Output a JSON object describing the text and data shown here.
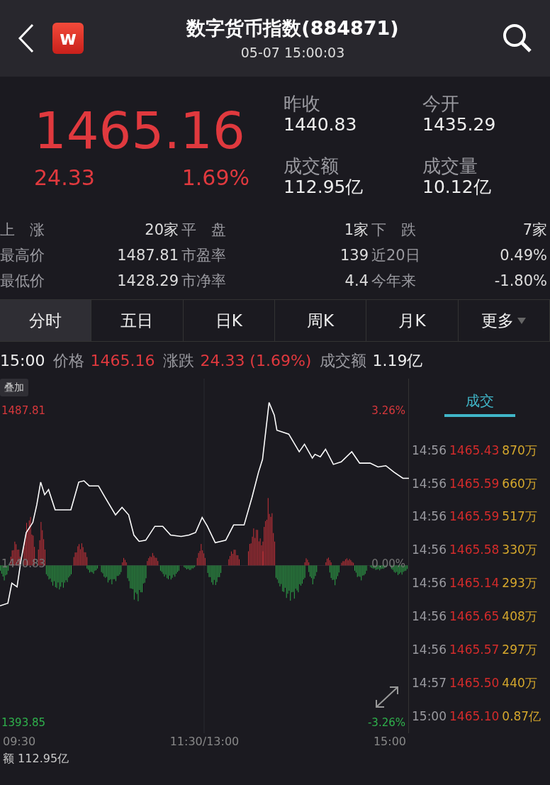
{
  "header": {
    "logo_text": "w",
    "title": "数字货币指数(884871)",
    "time": "05-07 15:00:03"
  },
  "quote": {
    "price": "1465.16",
    "change": "24.33",
    "change_pct": "1.69%",
    "fields": [
      {
        "label": "昨收",
        "value": "1440.83"
      },
      {
        "label": "今开",
        "value": "1435.29"
      },
      {
        "label": "成交额",
        "value": "112.95亿"
      },
      {
        "label": "成交量",
        "value": "10.12亿"
      }
    ]
  },
  "stats": [
    [
      {
        "label": "上　涨",
        "value": "20家"
      },
      {
        "label": "平　盘",
        "value": "1家"
      },
      {
        "label": "下　跌",
        "value": "7家"
      }
    ],
    [
      {
        "label": "最高价",
        "value": "1487.81"
      },
      {
        "label": "市盈率",
        "value": "139"
      },
      {
        "label": "近20日",
        "value": "0.49%"
      }
    ],
    [
      {
        "label": "最低价",
        "value": "1428.29"
      },
      {
        "label": "市净率",
        "value": "4.4"
      },
      {
        "label": "今年来",
        "value": "-1.80%"
      }
    ]
  ],
  "tabs": [
    {
      "label": "分时",
      "selected": true,
      "kind": "tab"
    },
    {
      "label": "五日",
      "selected": false,
      "kind": "tab"
    },
    {
      "label": "日K",
      "selected": false,
      "kind": "tab"
    },
    {
      "label": "周K",
      "selected": false,
      "kind": "tab"
    },
    {
      "label": "月K",
      "selected": false,
      "kind": "tab"
    },
    {
      "label": "更多",
      "selected": false,
      "kind": "menu"
    }
  ],
  "info": {
    "time": "15:00",
    "items": [
      {
        "label": "价格",
        "value": "1465.16",
        "color": "#e0393e"
      },
      {
        "label": "涨跌",
        "value": "24.33 (1.69%)",
        "color": "#e0393e"
      },
      {
        "label": "成交额",
        "value": "1.19亿",
        "color": "#eeeeee"
      }
    ]
  },
  "chart": {
    "overlay_button": "叠加",
    "high": "1487.81",
    "prev_close": "1440.83",
    "low": "1393.85",
    "high_pct": "3.26%",
    "zero_pct": "0.00%",
    "low_pct": "-3.26%",
    "x_labels": [
      "09:30",
      "11:30/13:00",
      "15:00"
    ]
  },
  "trades": {
    "tab": {
      "label": "成交",
      "selected": true
    },
    "rows": [
      {
        "time": "14:56",
        "price": "1465.43",
        "volume": "870万"
      },
      {
        "time": "14:56",
        "price": "1465.59",
        "volume": "660万"
      },
      {
        "time": "14:56",
        "price": "1465.59",
        "volume": "517万"
      },
      {
        "time": "14:56",
        "price": "1465.58",
        "volume": "330万"
      },
      {
        "time": "14:56",
        "price": "1465.14",
        "volume": "293万"
      },
      {
        "time": "14:56",
        "price": "1465.65",
        "volume": "408万"
      },
      {
        "time": "14:56",
        "price": "1465.57",
        "volume": "297万"
      },
      {
        "time": "14:57",
        "price": "1465.50",
        "volume": "440万"
      },
      {
        "time": "15:00",
        "price": "1465.10",
        "volume": "0.87亿"
      }
    ]
  },
  "footer": "额 112.95亿"
}
